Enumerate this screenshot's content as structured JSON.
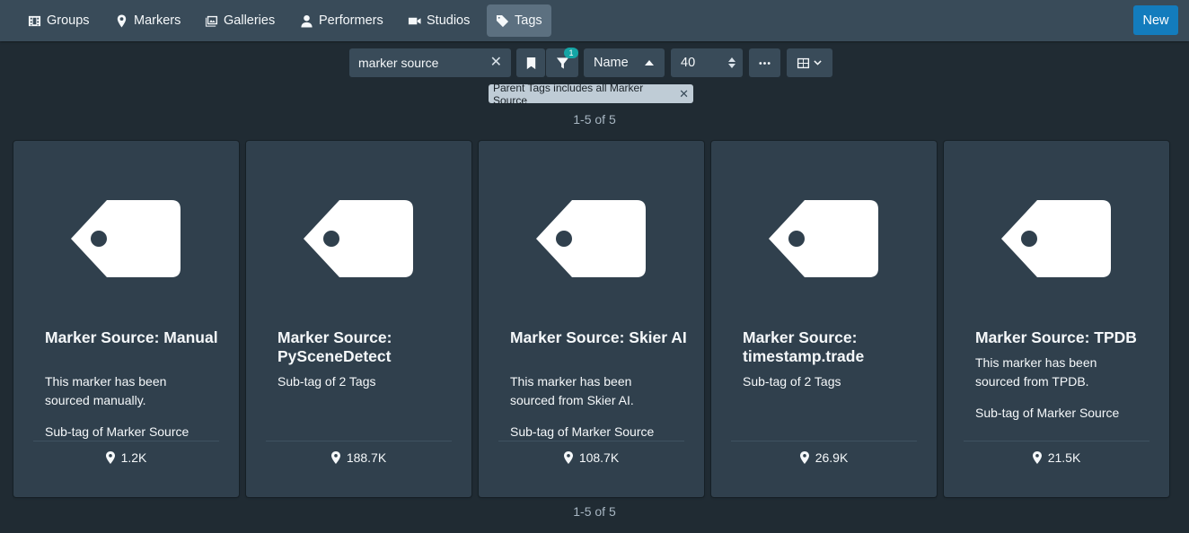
{
  "nav": {
    "items": [
      {
        "label": "Groups",
        "icon": "film-icon"
      },
      {
        "label": "Markers",
        "icon": "map-marker-icon"
      },
      {
        "label": "Galleries",
        "icon": "images-icon"
      },
      {
        "label": "Performers",
        "icon": "user-icon"
      },
      {
        "label": "Studios",
        "icon": "video-icon"
      },
      {
        "label": "Tags",
        "icon": "tag-icon",
        "active": true
      }
    ],
    "new_label": "New"
  },
  "toolbar": {
    "search_value": "marker source",
    "filter_count": "1",
    "sort_by": "Name",
    "per_page": "40"
  },
  "filter_tag": "Parent Tags includes all Marker Source",
  "pagination": {
    "top": "1-5 of 5",
    "bottom": "1-5 of 5"
  },
  "cards": [
    {
      "title": "Marker Source: Manual",
      "description": "This marker has been sourced manually.",
      "parent": "Sub-tag of Marker Source",
      "marker_count": "1.2K"
    },
    {
      "title": "Marker Source: PySceneDetect",
      "description": "Sub-tag of 2 Tags",
      "parent": "",
      "marker_count": "188.7K"
    },
    {
      "title": "Marker Source: Skier AI",
      "description": "This marker has been sourced from Skier AI.",
      "parent": "Sub-tag of Marker Source",
      "marker_count": "108.7K"
    },
    {
      "title": "Marker Source: timestamp.trade",
      "description": "Sub-tag of 2 Tags",
      "parent": "",
      "marker_count": "26.9K"
    },
    {
      "title": "Marker Source: TPDB",
      "description": "This marker has been sourced from TPDB.",
      "parent": "Sub-tag of Marker Source",
      "marker_count": "21.5K"
    }
  ],
  "colors": {
    "background": "#202b33",
    "navbar": "#394b59",
    "card": "#30404d",
    "primary": "#137cbd",
    "badge": "#15a5a5"
  }
}
